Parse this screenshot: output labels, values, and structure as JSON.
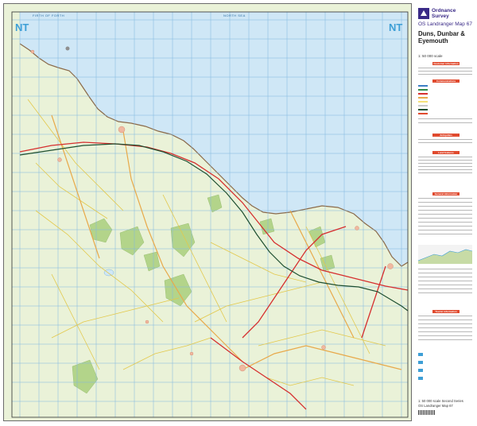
{
  "map": {
    "grid_labels": {
      "nw": "NT",
      "ne": "NT"
    },
    "colors": {
      "sea": "#cfe7f6",
      "land": "#eaf2d8",
      "woodland": "#b3d48a",
      "grid": "#7fb6e0",
      "railway": "#1e4f30",
      "a_road": "#d62f2f",
      "b_road": "#e8a94a",
      "minor_road": "#f5e27a"
    },
    "edge_texts": [
      "FIRTH OF FORTH",
      "NORTH SEA"
    ]
  },
  "legend": {
    "brand": {
      "line1": "Ordnance",
      "line2": "Survey"
    },
    "series": "OS Landranger Map 67",
    "title_lines": [
      "Duns, Dunbar &",
      "Eyemouth"
    ],
    "scale": "1: 50 000 scale",
    "panels": [
      "Customer information",
      "Communications",
      "Antiquities",
      "Land features",
      "General information",
      "Tourist information"
    ],
    "footer": [
      "1: 50 000 scale Second Series",
      "OS Landranger Map 67"
    ]
  }
}
